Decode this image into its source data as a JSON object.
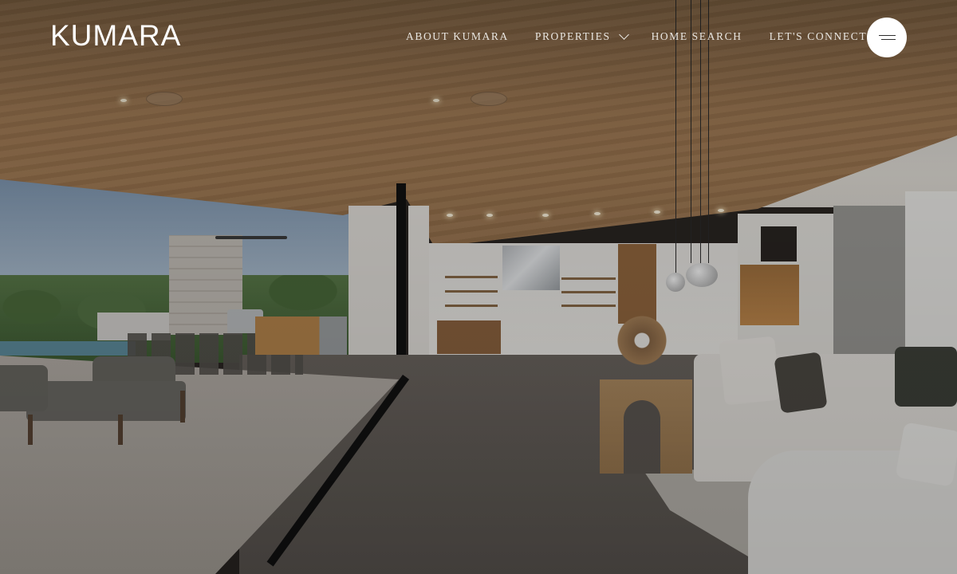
{
  "brand": {
    "logo_text": "KUMARA"
  },
  "nav": {
    "items": [
      {
        "label": "ABOUT KUMARA"
      },
      {
        "label": "PROPERTIES",
        "has_dropdown": true
      },
      {
        "label": "HOME SEARCH"
      },
      {
        "label": "LET'S CONNECT"
      }
    ],
    "menu_icon": "hamburger-menu-icon",
    "dropdown_icon": "chevron-down-icon"
  },
  "hero": {
    "image_subject": "modern open-plan living room and kitchen opening to covered patio with pool and hill-country view"
  },
  "colors": {
    "nav_text": "#e9e6e1",
    "logo": "#ffffff",
    "menu_button_bg": "#ffffff",
    "overlay": "#000000"
  }
}
